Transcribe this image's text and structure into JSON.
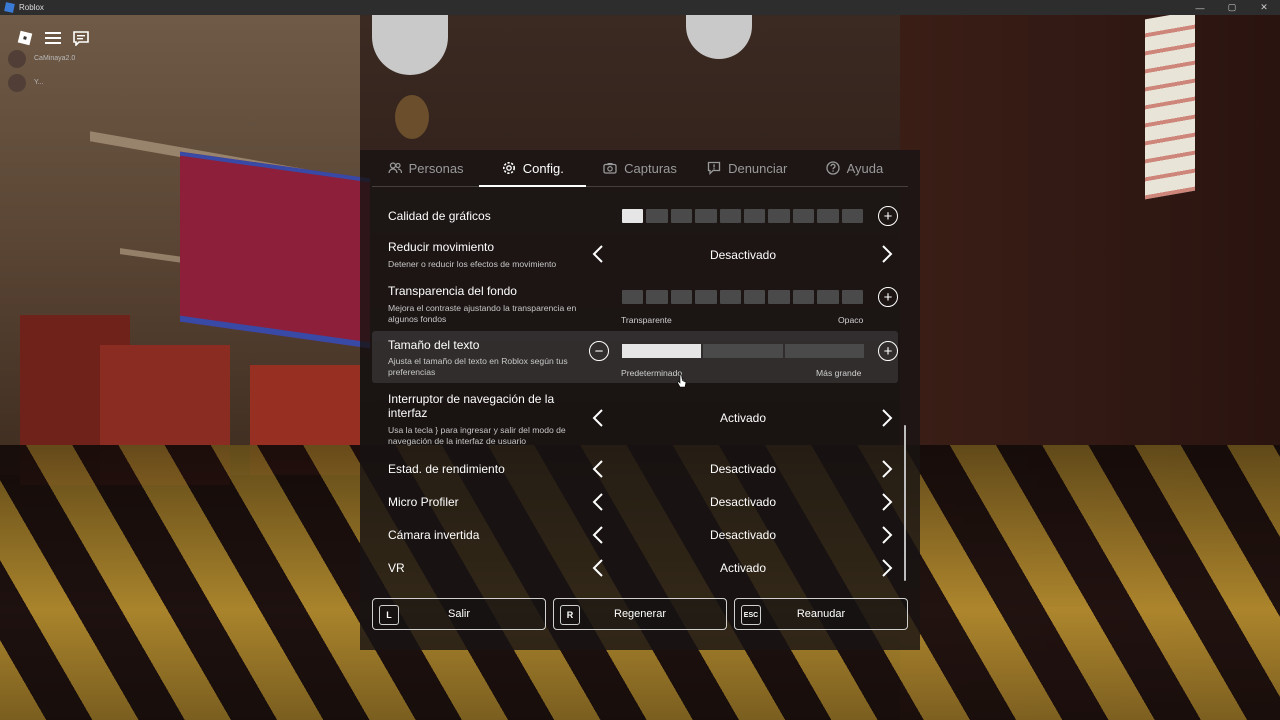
{
  "window": {
    "title": "Roblox",
    "controls": [
      "—",
      "▢",
      "✕"
    ]
  },
  "hud": {
    "players": [
      {
        "name": "CaMinaya2.0"
      },
      {
        "name": "Y..."
      }
    ]
  },
  "tabs": [
    {
      "label": "Personas",
      "icon": "people-icon",
      "active": false
    },
    {
      "label": "Config.",
      "icon": "gear-icon",
      "active": true
    },
    {
      "label": "Capturas",
      "icon": "camera-icon",
      "active": false
    },
    {
      "label": "Denunciar",
      "icon": "flag-icon",
      "active": false
    },
    {
      "label": "Ayuda",
      "icon": "help-icon",
      "active": false
    }
  ],
  "settings": {
    "graphics": {
      "label": "Calidad de gráficos",
      "level": 1,
      "max": 10
    },
    "reduce_motion": {
      "label": "Reducir movimiento",
      "description": "Detener o reducir los efectos de movimiento",
      "value": "Desactivado"
    },
    "bg_transparency": {
      "label": "Transparencia del fondo",
      "description": "Mejora el contraste ajustando la transparencia en algunos fondos",
      "min_label": "Transparente",
      "max_label": "Opaco",
      "level": 0,
      "max": 10
    },
    "text_size": {
      "label": "Tamaño del texto",
      "description": "Ajusta el tamaño del texto en Roblox según tus preferencias",
      "min_label": "Predeterminado",
      "max_label": "Más grande",
      "level": 1,
      "max": 3
    },
    "ui_nav": {
      "label": "Interruptor de navegación de la interfaz",
      "description": "Usa la tecla } para ingresar y salir del modo de navegación de la interfaz de usuario",
      "value": "Activado"
    },
    "perf_stats": {
      "label": "Estad. de rendimiento",
      "value": "Desactivado"
    },
    "micro_profiler": {
      "label": "Micro Profiler",
      "value": "Desactivado"
    },
    "inverted_camera": {
      "label": "Cámara invertida",
      "value": "Desactivado"
    },
    "vr": {
      "label": "VR",
      "value": "Activado"
    }
  },
  "buttons": {
    "leave": {
      "key": "L",
      "label": "Salir"
    },
    "reset": {
      "key": "R",
      "label": "Regenerar"
    },
    "resume": {
      "key": "ESC",
      "label": "Reanudar"
    }
  }
}
